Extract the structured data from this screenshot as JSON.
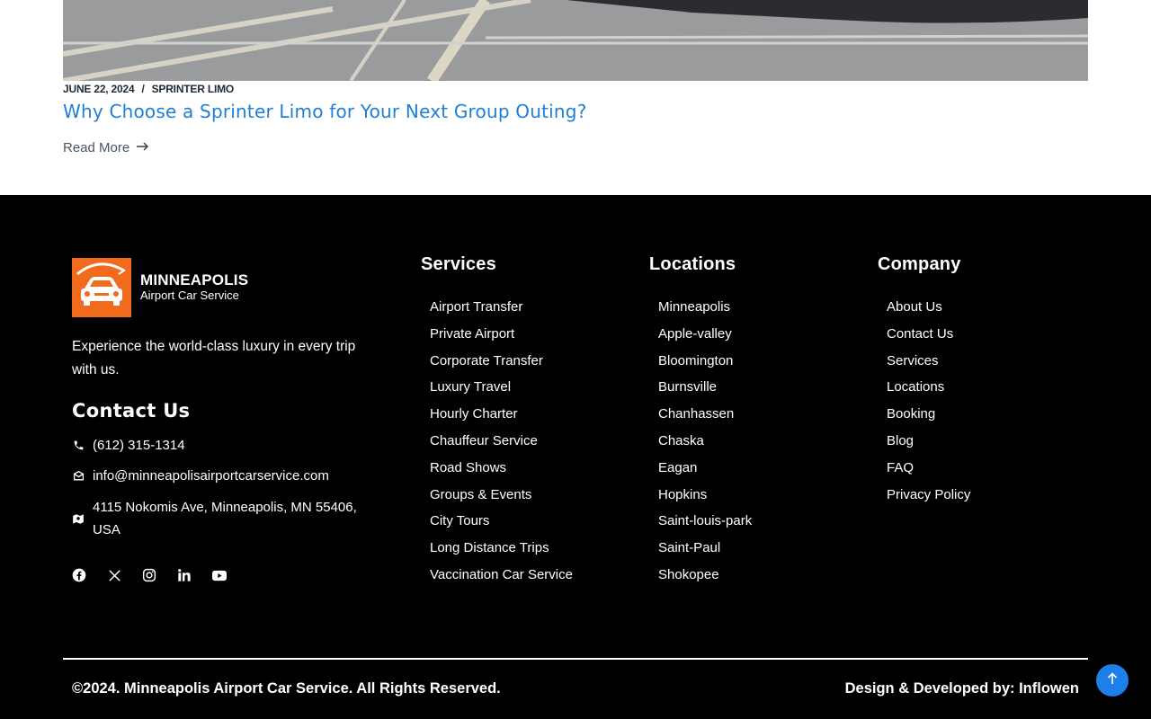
{
  "post": {
    "date": "JUNE 22, 2024",
    "separator": "/",
    "category": "SPRINTER LIMO",
    "title": "Why Choose a Sprinter Limo for Your Next Group Outing?",
    "read_more": "Read More",
    "read_more_icon": "arrow-right-icon"
  },
  "footer": {
    "logo": {
      "brand": "MINNEAPOLIS",
      "tagline": "Airport Car Service"
    },
    "tagline": "Experience the world-class luxury in every trip with us.",
    "contact": {
      "title": "Contact Us",
      "phone": "(612) 315-1314",
      "email": "info@minneapolisairportcarservice.com",
      "address": "4115 Nokomis Ave, Minneapolis, MN 55406, USA"
    },
    "social": [
      "facebook-icon",
      "x-twitter-icon",
      "instagram-icon",
      "linkedin-icon",
      "youtube-icon"
    ],
    "services": {
      "title": "Services",
      "items": [
        "Airport Transfer",
        "Private Airport",
        "Corporate Transfer",
        "Luxury Travel",
        "Hourly Charter",
        "Chauffeur Service",
        "Road Shows",
        "Groups & Events",
        "City Tours",
        "Long Distance Trips",
        "Vaccination Car Service"
      ]
    },
    "locations": {
      "title": "Locations",
      "items": [
        "Minneapolis",
        "Apple-valley",
        "Bloomington",
        "Burnsville",
        "Chanhassen",
        "Chaska",
        "Eagan",
        "Hopkins",
        "Saint-louis-park",
        "Saint-Paul",
        "Shokopee"
      ]
    },
    "company": {
      "title": "Company",
      "items": [
        "About Us",
        "Contact Us",
        "Services",
        "Locations",
        "Booking",
        "Blog",
        "FAQ",
        "Privacy Policy"
      ]
    },
    "copyright": "©2024. Minneapolis Airport Car Service. All Rights Reserved.",
    "credit": "Design & Developed by: Inflowen"
  },
  "colors": {
    "accent_blue": "#1f7fd6",
    "logo_orange": "#f26a1b",
    "footer_bg": "#000000"
  }
}
